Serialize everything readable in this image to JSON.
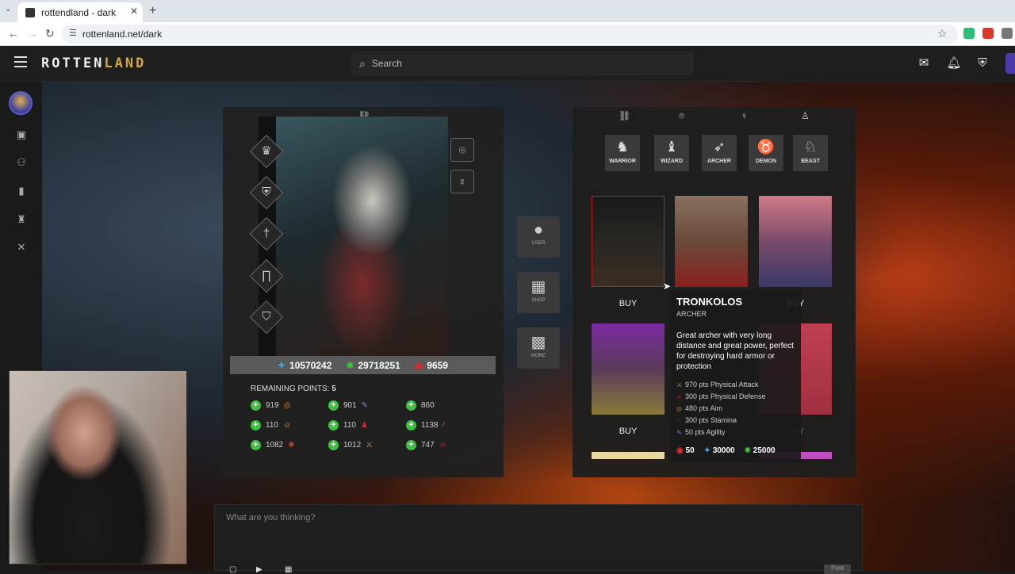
{
  "browser": {
    "tab_title": "rottendland - dark",
    "tab_close": "✕",
    "new_tab": "+",
    "url": "rottenland.net/dark"
  },
  "app": {
    "logo_main": "ROTTEN",
    "logo_accent": "LAND",
    "search_placeholder": "Search"
  },
  "character": {
    "currencies": [
      {
        "icon": "diamond-icon",
        "value": "10570242",
        "color": "#3fa8e0"
      },
      {
        "icon": "gem-icon",
        "value": "29718251",
        "color": "#3fbf3f"
      },
      {
        "icon": "ruby-icon",
        "value": "9659",
        "color": "#d03030"
      }
    ],
    "remaining_label": "REMAINING POINTS:",
    "remaining_value": "5",
    "attributes": [
      {
        "value": "919",
        "icon": "target-icon"
      },
      {
        "value": "901",
        "icon": "feather-icon"
      },
      {
        "value": "860",
        "icon": "heart-icon"
      },
      {
        "value": "110",
        "icon": "smile-icon"
      },
      {
        "value": "110",
        "icon": "potion-icon"
      },
      {
        "value": "1138",
        "icon": "wand-icon"
      },
      {
        "value": "1082",
        "icon": "bug-icon"
      },
      {
        "value": "1012",
        "icon": "swords-icon"
      },
      {
        "value": "747",
        "icon": "skull-icon"
      }
    ]
  },
  "mid_nav": [
    {
      "label": "USER",
      "icon": "user-icon"
    },
    {
      "label": "SHOP",
      "icon": "shop-icon"
    },
    {
      "label": "MORE",
      "icon": "grid-icon"
    }
  ],
  "shop": {
    "categories": [
      {
        "label": "WARRIOR",
        "icon": "helmet-icon"
      },
      {
        "label": "WIZARD",
        "icon": "wizard-icon"
      },
      {
        "label": "ARCHER",
        "icon": "bow-icon"
      },
      {
        "label": "DEMON",
        "icon": "demon-icon"
      },
      {
        "label": "BEAST",
        "icon": "beast-icon"
      }
    ],
    "buy_label": "BUY",
    "tooltip": {
      "name": "TRONKOLOS",
      "class": "ARCHER",
      "description": "Great archer with very long distance and great power, perfect for destroying hard armor or protection",
      "stats": [
        "970 pts Physical Attack",
        "300 pts Physical Defense",
        "480 pts Aim",
        "300 pts Stamina",
        "50 pts Agility"
      ],
      "prices": [
        "50",
        "30000",
        "25000"
      ]
    }
  },
  "composer": {
    "placeholder": "What are you thinking?",
    "post_label": "Post"
  }
}
